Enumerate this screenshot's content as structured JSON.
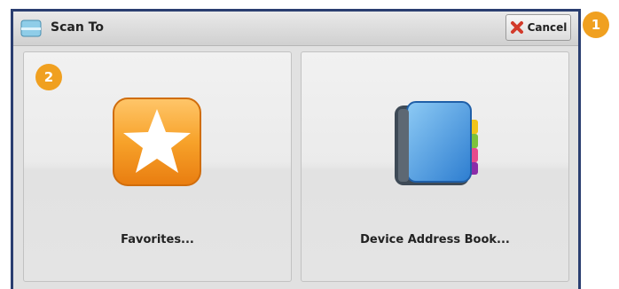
{
  "title_bar": {
    "title": "Scan To",
    "cancel_label": "Cancel"
  },
  "tiles": [
    {
      "label": "Favorites...",
      "icon": "star-icon"
    },
    {
      "label": "Device Address Book...",
      "icon": "address-book-icon"
    }
  ],
  "callouts": [
    "1",
    "2"
  ],
  "colors": {
    "frame": "#2a3e70",
    "callout": "#f0a020",
    "star_tile": "#f39a1e"
  }
}
